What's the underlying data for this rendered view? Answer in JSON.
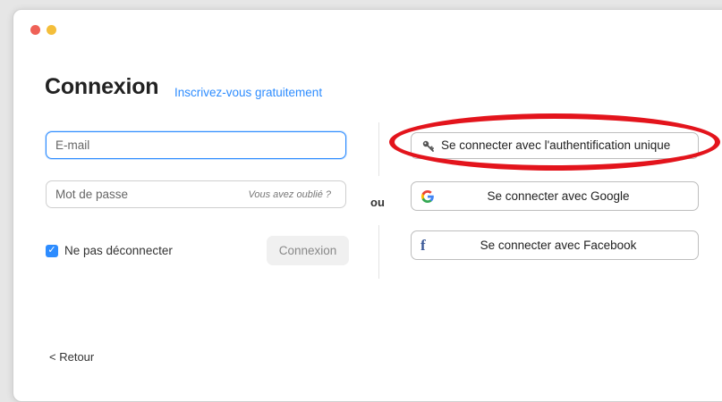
{
  "window": {
    "colors": {
      "close": "#ef6157",
      "minimize": "#f4be3a"
    }
  },
  "header": {
    "title": "Connexion",
    "signup_link": "Inscrivez-vous gratuitement"
  },
  "form": {
    "email": {
      "placeholder": "E-mail",
      "value": ""
    },
    "password": {
      "placeholder": "Mot de passe",
      "value": "",
      "forgot_link": "Vous avez oublié ?"
    },
    "keep_signed_in": {
      "label": "Ne pas déconnecter",
      "checked": true
    },
    "login_button": "Connexion"
  },
  "divider": {
    "label": "ou"
  },
  "social": {
    "sso": {
      "label": "Se connecter avec l'authentification unique",
      "icon": "key-icon"
    },
    "google": {
      "label": "Se connecter avec Google",
      "icon": "google-icon"
    },
    "facebook": {
      "label": "Se connecter avec Facebook",
      "icon": "facebook-icon"
    }
  },
  "annotation": {
    "color": "#e3141c"
  },
  "footer": {
    "back": "Retour"
  },
  "colors": {
    "accent": "#2d8cff",
    "facebook": "#3b5998"
  }
}
